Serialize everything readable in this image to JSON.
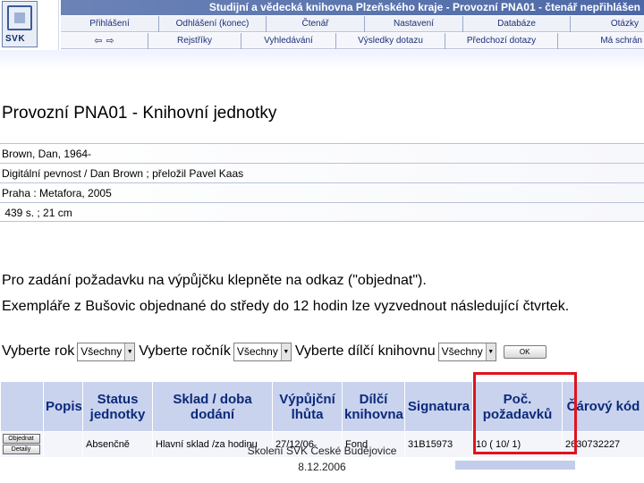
{
  "header": {
    "logo_text": "SVK",
    "title": "Studijní a vědecká knihovna Plzeňského kraje - Provozní PNA01 - čtenář nepřihlášen",
    "nav_row_1": [
      {
        "label": "Přihlášení"
      },
      {
        "label": "Odhlášení (konec)"
      },
      {
        "label": "Čtenář"
      },
      {
        "label": "Nastavení"
      },
      {
        "label": "Databáze"
      },
      {
        "label": "Otázky"
      }
    ],
    "nav_row_2": {
      "back_icon": "arrow-left-icon",
      "forward_icon": "arrow-right-icon",
      "back_glyph": "⇦",
      "forward_glyph": "⇨",
      "items": [
        {
          "label": "Rejstříky"
        },
        {
          "label": "Vyhledávání"
        },
        {
          "label": "Výsledky dotazu"
        },
        {
          "label": "Předchozí dotazy"
        },
        {
          "label": "Má schrán"
        }
      ]
    }
  },
  "main": {
    "title": "Provozní PNA01 - Knihovní jednotky",
    "record": [
      "Brown, Dan, 1964-",
      "Digitální pevnost / Dan Brown ; přeložil Pavel Kaas",
      "Praha : Metafora, 2005",
      " 439 s. ; 21 cm"
    ],
    "instruction_1": "Pro zadání požadavku na výpůjčku klepněte na odkaz (\"objednat\").",
    "instruction_2": "Exempláře z Bušovic objednané do středy do 12 hodin lze vyzvednout následující čtvrtek.",
    "filters": {
      "year_label": "Vyberte rok",
      "year_value": "Všechny",
      "volume_label": "Vyberte ročník",
      "volume_value": "Všechny",
      "sublibrary_label": "Vyberte dílčí knihovnu",
      "sublibrary_value": "Všechny",
      "ok_label": "OK",
      "dropdown_glyph": "▼"
    },
    "table": {
      "headers": [
        "",
        "Popis",
        "Status jednotky",
        "Sklad / doba dodání",
        "Výpůjční lhůta",
        "Dílčí knihovna",
        "Signatura",
        "Poč. požadavků",
        "Čárový kód"
      ],
      "row": {
        "order_button": "Objednat",
        "details_button": "Detaily",
        "description": "",
        "status": "Absenčně",
        "storage": "Hlavní sklad /za hodinu",
        "loan_period": "27/12/06",
        "sublibrary": "Fond",
        "call_number": "31B15973",
        "requests": "10 ( 10/ 1)",
        "barcode": "2630732227"
      }
    }
  },
  "footer": {
    "line_1": "Školení SVK České Budějovice",
    "line_2": "8.12.2006"
  },
  "colors": {
    "title_bar": "#5a74ad",
    "table_header": "#c9d3ee",
    "header_text": "#0c2a7a",
    "highlight": "#e0141e"
  }
}
